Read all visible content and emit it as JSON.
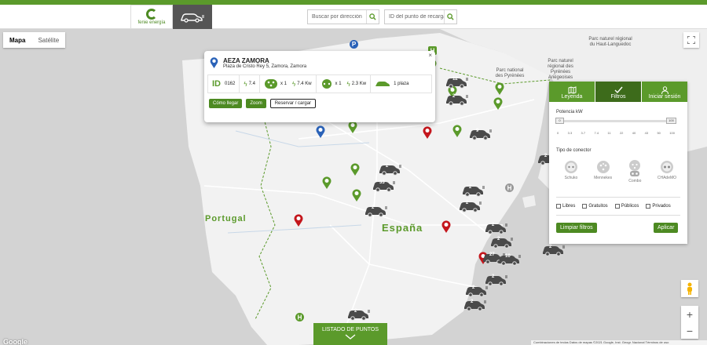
{
  "brand": {
    "name": "fenie energía",
    "color": "#5b9a2b",
    "dark": "#3d6b1b"
  },
  "header": {
    "search_address_placeholder": "Buscar por dirección",
    "search_id_placeholder": "ID del punto de recarga",
    "ev_tab_icon": "car-plug-icon"
  },
  "map": {
    "type_controls": [
      "Mapa",
      "Satélite"
    ],
    "active_type": "Mapa",
    "countries": [
      "Portugal",
      "España"
    ],
    "region_labels": [
      "Parc naturel régional des Pyrénées Ariégeoises",
      "Parc national des Pyrénées",
      "Parc naturel régional du Haut-Languedoc"
    ],
    "cluster_counts": [
      "12",
      "2",
      "9",
      "2",
      "33",
      "2",
      "2",
      "2",
      "2",
      "2",
      "2",
      "27",
      "10",
      "2",
      "2",
      "2",
      "2",
      "2",
      "2",
      "2",
      "2"
    ],
    "attribution": "Combinaciones de teclas   Datos de mapas ©2021 Google, Inst. Geogr. Nacional   Términos de uso",
    "google_logo": "Google"
  },
  "popup": {
    "close_icon": "close-icon",
    "title": "AEZA ZAMORA",
    "address": "Plaza de Cristo Rey 5, Zamora, Zamora",
    "id_label": "ID",
    "id_value": "0162",
    "power_total": "7.4",
    "connector1_count": "x 1",
    "connector1_power": "7.4 Kw",
    "connector2_count": "x 1",
    "connector2_power": "2.3 Kw",
    "places": "1 plaza",
    "buttons": {
      "directions": "Cómo llegar",
      "zoom": "Zoom",
      "reserve": "Reservar / cargar"
    }
  },
  "panel": {
    "tabs": [
      {
        "label": "Leyenda",
        "icon": "map-icon"
      },
      {
        "label": "Filtros",
        "icon": "check-icon"
      },
      {
        "label": "Iniciar sesión",
        "icon": "user-icon"
      }
    ],
    "active_tab": "Filtros",
    "power_label": "Potencia kW",
    "slider_min": "0",
    "slider_max": "100",
    "ticks": [
      "0",
      "3.3",
      "3.7",
      "7.4",
      "11",
      "22",
      "40",
      "43",
      "50",
      "100"
    ],
    "connector_label": "Tipo de conector",
    "connectors": [
      "Schuko",
      "Mennekes",
      "Combo",
      "CHAdeMO"
    ],
    "checkboxes": [
      "Libres",
      "Gratuitos",
      "Públicos",
      "Privados"
    ],
    "clear_button": "Limpiar filtros",
    "apply_button": "Aplicar"
  },
  "listing_button": "LISTADO DE PUNTOS"
}
